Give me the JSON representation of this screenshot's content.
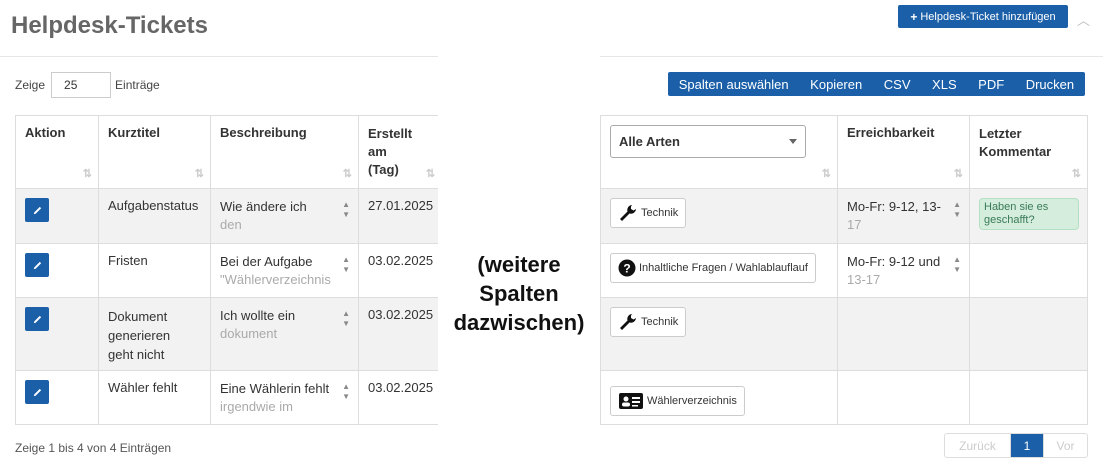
{
  "header": {
    "title": "Helpdesk-Tickets",
    "add_button": "Helpdesk-Ticket hinzufügen"
  },
  "length": {
    "prefix": "Zeige",
    "value": "25",
    "suffix": "Einträge"
  },
  "exports": [
    "Spalten auswählen",
    "Kopieren",
    "CSV",
    "XLS",
    "PDF",
    "Drucken"
  ],
  "columns_left": [
    "Aktion",
    "Kurztitel",
    "Beschreibung",
    "Erstellt am (Tag)"
  ],
  "type_filter": "Alle Arten",
  "columns_right": [
    "Erreichbarkeit",
    "Letzter Kommentar"
  ],
  "rows": [
    {
      "kurztitel": "Aufgabenstatus",
      "desc1": "Wie ändere ich",
      "desc2": "den",
      "date": "27.01.2025",
      "type": "Technik",
      "reach1": "Mo-Fr: 9-12, 13-",
      "reach2": "17",
      "comment": "Haben sie es geschafft?"
    },
    {
      "kurztitel": "Fristen",
      "desc1": "Bei der Aufgabe",
      "desc2": "\"Wählerverzeichnis",
      "date": "03.02.2025",
      "type": "Inhaltliche Fragen / Wahlablauflauf",
      "reach1": "Mo-Fr: 9-12 und",
      "reach2": "13-17",
      "comment": ""
    },
    {
      "kurztitel": "Dokument generieren geht nicht",
      "desc1": "Ich wollte ein",
      "desc2": "dokument",
      "date": "03.02.2025",
      "type": "Technik",
      "reach1": "",
      "reach2": "",
      "comment": ""
    },
    {
      "kurztitel": "Wähler fehlt",
      "desc1": "Eine Wählerin fehlt",
      "desc2": "irgendwie im",
      "date": "03.02.2025",
      "type": "Wählerverzeichnis",
      "reach1": "",
      "reach2": "",
      "comment": ""
    }
  ],
  "overlay_note": "(weitere Spalten dazwischen)",
  "footer": {
    "info": "Zeige 1 bis 4 von 4 Einträgen",
    "prev": "Zurück",
    "page": "1",
    "next": "Vor"
  },
  "colors": {
    "primary": "#1a5fa8",
    "comment_bg": "#d4eddd"
  },
  "icons": {
    "technik": "wrench-icon",
    "fragen": "question-circle-icon",
    "waehler": "id-card-icon",
    "edit": "pencil-icon"
  }
}
